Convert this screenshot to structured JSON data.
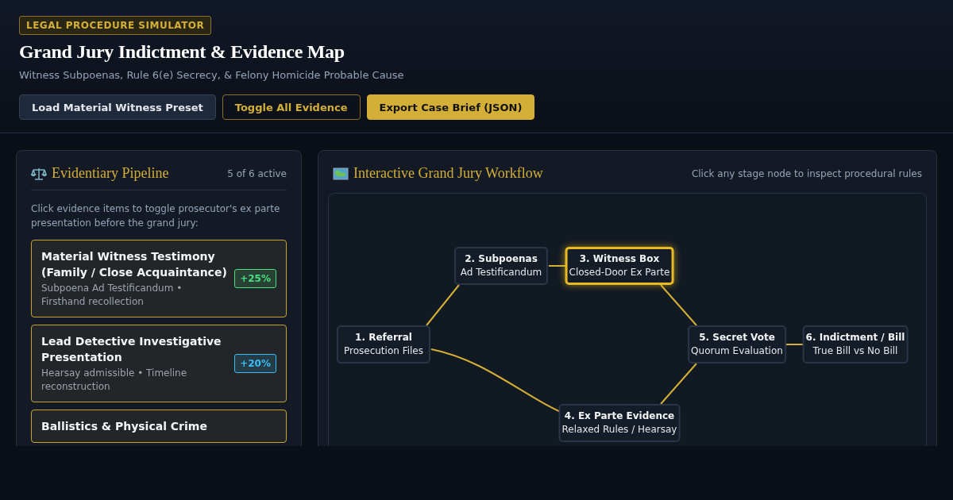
{
  "header": {
    "badge": "LEGAL PROCEDURE SIMULATOR",
    "title": "Grand Jury Indictment & Evidence Map",
    "subtitle": "Witness Subpoenas, Rule 6(e) Secrecy, & Felony Homicide Probable Cause",
    "buttons": [
      {
        "label": "Load Material Witness Preset",
        "kind": "secondary"
      },
      {
        "label": "Toggle All Evidence",
        "kind": "outline"
      },
      {
        "label": "Export Case Brief (JSON)",
        "kind": "primary"
      }
    ]
  },
  "evidence_panel": {
    "title": "Evidentiary Pipeline",
    "count": "5 of 6 active",
    "instructions": "Click evidence items to toggle prosecutor's ex parte presentation before the grand jury:",
    "items": [
      {
        "title": "Material Witness Testimony (Family / Close Acquaintance)",
        "detail": "Subpoena Ad Testificandum • Firsthand recollection",
        "boost": "+25%",
        "color": "#4ade80",
        "active": true
      },
      {
        "title": "Lead Detective Investigative Presentation",
        "detail": "Hearsay admissible • Timeline reconstruction",
        "boost": "+20%",
        "color": "#38bdf8",
        "active": true
      },
      {
        "title": "Ballistics & Physical Crime",
        "active": true
      }
    ]
  },
  "workflow_panel": {
    "title": "Interactive Grand Jury Workflow",
    "hint": "Click any stage node to inspect procedural rules",
    "nodes": [
      {
        "title": "1. Referral",
        "subtitle": "Prosecution Files",
        "selected": false
      },
      {
        "title": "2. Subpoenas",
        "subtitle": "Ad Testificandum",
        "selected": false
      },
      {
        "title": "3. Witness Box",
        "subtitle": "Closed-Door Ex Parte",
        "selected": true
      },
      {
        "title": "4. Ex Parte Evidence",
        "subtitle": "Relaxed Rules / Hearsay",
        "selected": false
      },
      {
        "title": "5. Secret Vote",
        "subtitle": "Quorum Evaluation",
        "selected": false
      },
      {
        "title": "6. Indictment / Bill",
        "subtitle": "True Bill vs No Bill",
        "selected": false
      }
    ]
  }
}
